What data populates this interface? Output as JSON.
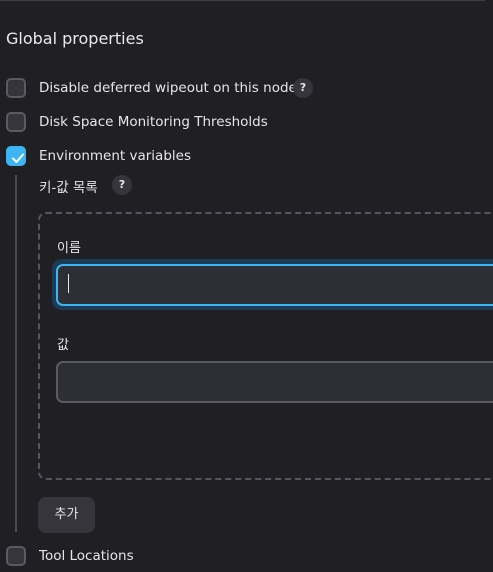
{
  "section": {
    "title": "Global properties"
  },
  "options": [
    {
      "label": "Disable deferred wipeout on this node",
      "checked": false,
      "help_icon": "?"
    },
    {
      "label": "Disk Space Monitoring Thresholds",
      "checked": false
    },
    {
      "label": "Environment variables",
      "checked": true
    },
    {
      "label": "Tool Locations",
      "checked": false
    }
  ],
  "env_vars": {
    "list_label": "키-값 목록",
    "help_icon": "?",
    "name_label": "이름",
    "name_value": "",
    "value_label": "값",
    "value_value": "",
    "add_button": "추가"
  },
  "colors": {
    "background": "#202024",
    "accent": "#3cb6f2",
    "field": "#2e2e35",
    "control": "#35353b"
  }
}
